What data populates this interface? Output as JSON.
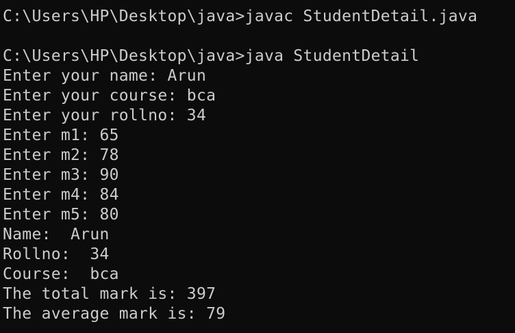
{
  "terminal": {
    "lines": [
      "C:\\Users\\HP\\Desktop\\java>javac StudentDetail.java",
      "",
      "C:\\Users\\HP\\Desktop\\java>java StudentDetail",
      "Enter your name: Arun",
      "Enter your course: bca",
      "Enter your rollno: 34",
      "Enter m1: 65",
      "Enter m2: 78",
      "Enter m3: 90",
      "Enter m4: 84",
      "Enter m5: 80",
      "Name:  Arun",
      "Rollno:  34",
      "Course:  bca",
      "The total mark is: 397",
      "The average mark is: 79"
    ]
  },
  "colors": {
    "background": "#0c0c0c",
    "foreground": "#cccccc"
  }
}
